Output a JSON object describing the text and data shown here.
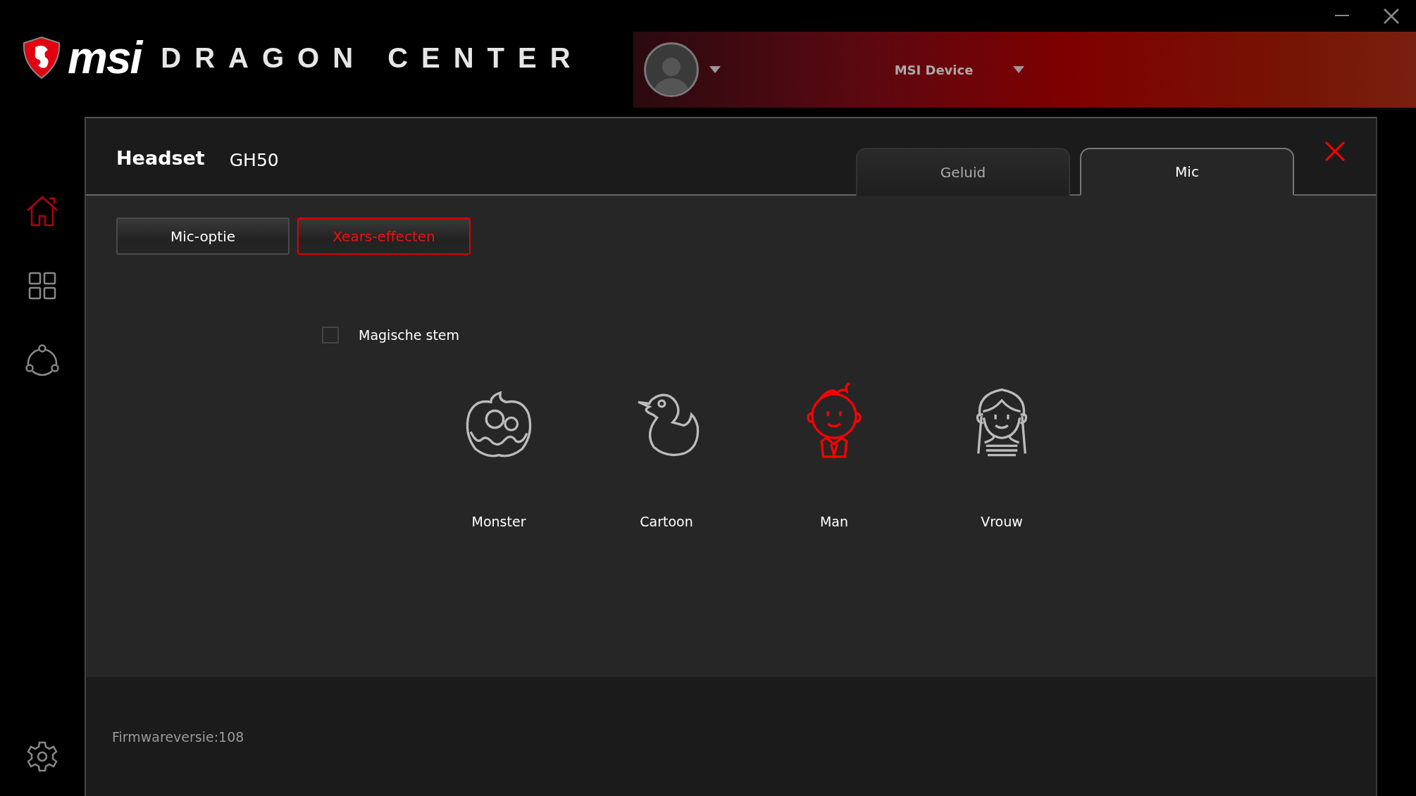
{
  "app": {
    "brand": "msi",
    "title": "DRAGON CENTER"
  },
  "device_selector": {
    "label": "MSI Device"
  },
  "sidebar": {
    "items": [
      {
        "kind": "home",
        "selected": true
      },
      {
        "kind": "apps",
        "selected": false
      },
      {
        "kind": "share",
        "selected": false
      }
    ]
  },
  "panel": {
    "device_type": "Headset",
    "model": "GH50",
    "tabs": [
      {
        "label": "Geluid",
        "selected": false
      },
      {
        "label": "Mic",
        "selected": true
      }
    ],
    "subtabs": [
      {
        "label": "Mic-optie",
        "selected": false
      },
      {
        "label": "Xears-effecten",
        "selected": true
      }
    ],
    "magic_voice": {
      "label": "Magische stem",
      "checked": false
    },
    "effects": [
      {
        "kind": "monster",
        "label": "Monster",
        "selected": false
      },
      {
        "kind": "cartoon",
        "label": "Cartoon",
        "selected": false
      },
      {
        "kind": "man",
        "label": "Man",
        "selected": true
      },
      {
        "kind": "woman",
        "label": "Vrouw",
        "selected": false
      }
    ],
    "firmware": "Firmwareversie:108"
  }
}
